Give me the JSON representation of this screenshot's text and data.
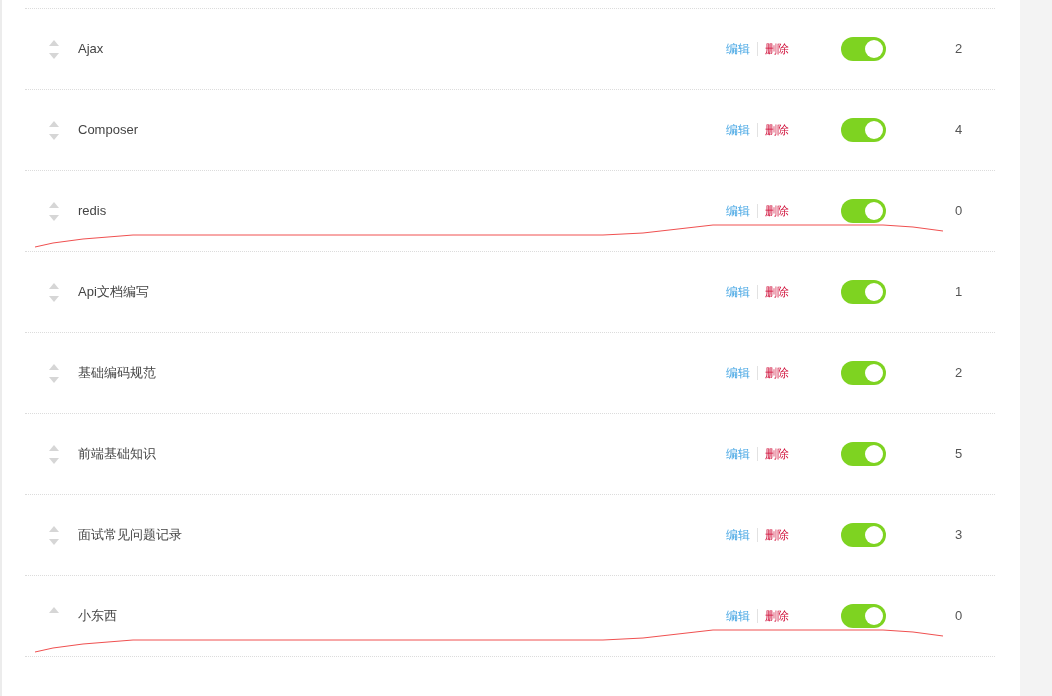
{
  "rows": [
    {
      "name": "Ajax",
      "can_move_down": true,
      "edit": "编辑",
      "delete": "删除",
      "on": true,
      "count": "2",
      "underlined": false
    },
    {
      "name": "Composer",
      "can_move_down": true,
      "edit": "编辑",
      "delete": "删除",
      "on": true,
      "count": "4",
      "underlined": false
    },
    {
      "name": "redis",
      "can_move_down": true,
      "edit": "编辑",
      "delete": "删除",
      "on": true,
      "count": "0",
      "underlined": true
    },
    {
      "name": "Api文档编写",
      "can_move_down": true,
      "edit": "编辑",
      "delete": "删除",
      "on": true,
      "count": "1",
      "underlined": false
    },
    {
      "name": "基础编码规范",
      "can_move_down": true,
      "edit": "编辑",
      "delete": "删除",
      "on": true,
      "count": "2",
      "underlined": false
    },
    {
      "name": "前端基础知识",
      "can_move_down": true,
      "edit": "编辑",
      "delete": "删除",
      "on": true,
      "count": "5",
      "underlined": false
    },
    {
      "name": "面试常见问题记录",
      "can_move_down": true,
      "edit": "编辑",
      "delete": "删除",
      "on": true,
      "count": "3",
      "underlined": false
    },
    {
      "name": "小东西",
      "can_move_down": false,
      "edit": "编辑",
      "delete": "删除",
      "on": true,
      "count": "0",
      "underlined": true
    }
  ]
}
